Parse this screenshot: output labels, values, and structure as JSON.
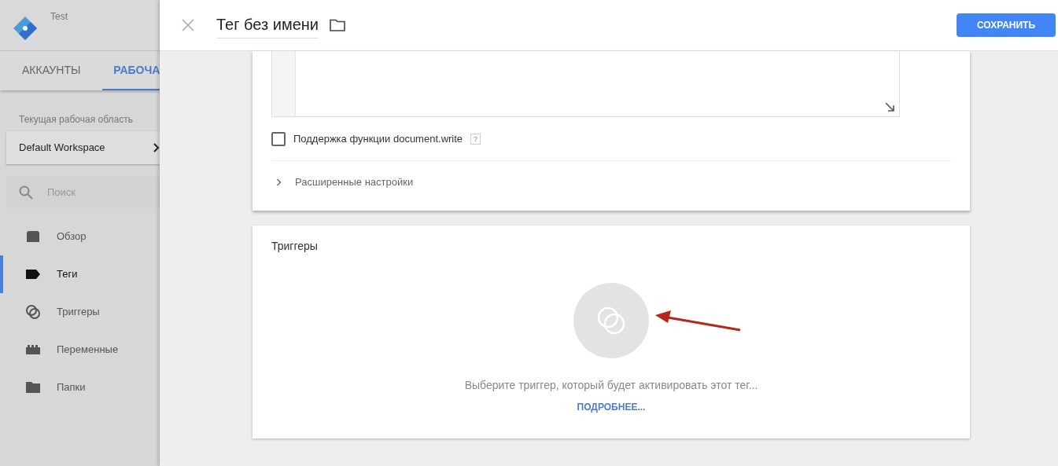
{
  "sidebar": {
    "account": "Test",
    "tabs": [
      {
        "label": "АККАУНТЫ",
        "selected": false
      },
      {
        "label": "РАБОЧА",
        "selected": true
      }
    ],
    "workspace_label": "Текущая рабочая область",
    "workspace": "Default Workspace",
    "search": {
      "placeholder": "Поиск"
    },
    "items": [
      {
        "label": "Обзор",
        "kind": "overview",
        "selected": false
      },
      {
        "label": "Теги",
        "kind": "tags",
        "selected": true
      },
      {
        "label": "Триггеры",
        "kind": "triggers",
        "selected": false
      },
      {
        "label": "Переменные",
        "kind": "variables",
        "selected": false
      },
      {
        "label": "Папки",
        "kind": "folders",
        "selected": false
      }
    ]
  },
  "editor": {
    "title": "Тег без имени",
    "save": "СОХРАНИТЬ",
    "document_write": {
      "label": "Поддержка функции document.write",
      "help": "?",
      "checked": false
    },
    "advanced": {
      "label": "Расширенные настройки",
      "expanded": false
    },
    "triggers": {
      "title": "Триггеры",
      "hint": "Выберите триггер, который будет активировать этот тег...",
      "link": "ПОДРОБНЕЕ..."
    }
  }
}
